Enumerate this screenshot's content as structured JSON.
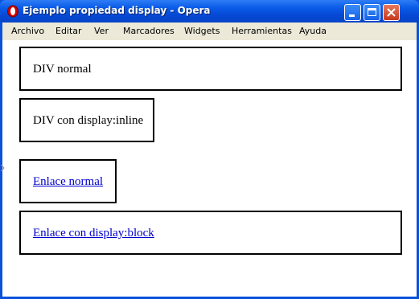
{
  "window": {
    "title": "Ejemplo propiedad display - Opera",
    "app_icon": "opera-icon",
    "controls": [
      "minimize-icon",
      "maximize-icon",
      "close-icon"
    ]
  },
  "menubar": {
    "items": [
      {
        "label": "Archivo"
      },
      {
        "label": "Editar"
      },
      {
        "label": "Ver"
      },
      {
        "label": "Marcadores"
      },
      {
        "label": "Widgets"
      },
      {
        "label": "Herramientas"
      },
      {
        "label": "Ayuda"
      }
    ]
  },
  "content": {
    "div_normal": "DIV normal",
    "div_inline": "DIV con display:inline",
    "link_normal": "Enlace normal",
    "link_block": "Enlace con display:block",
    "link_color": "#0000cc"
  },
  "colors": {
    "titlebar": "#0a5be8",
    "menubar": "#ece9d8",
    "close_button": "#c7381c"
  }
}
